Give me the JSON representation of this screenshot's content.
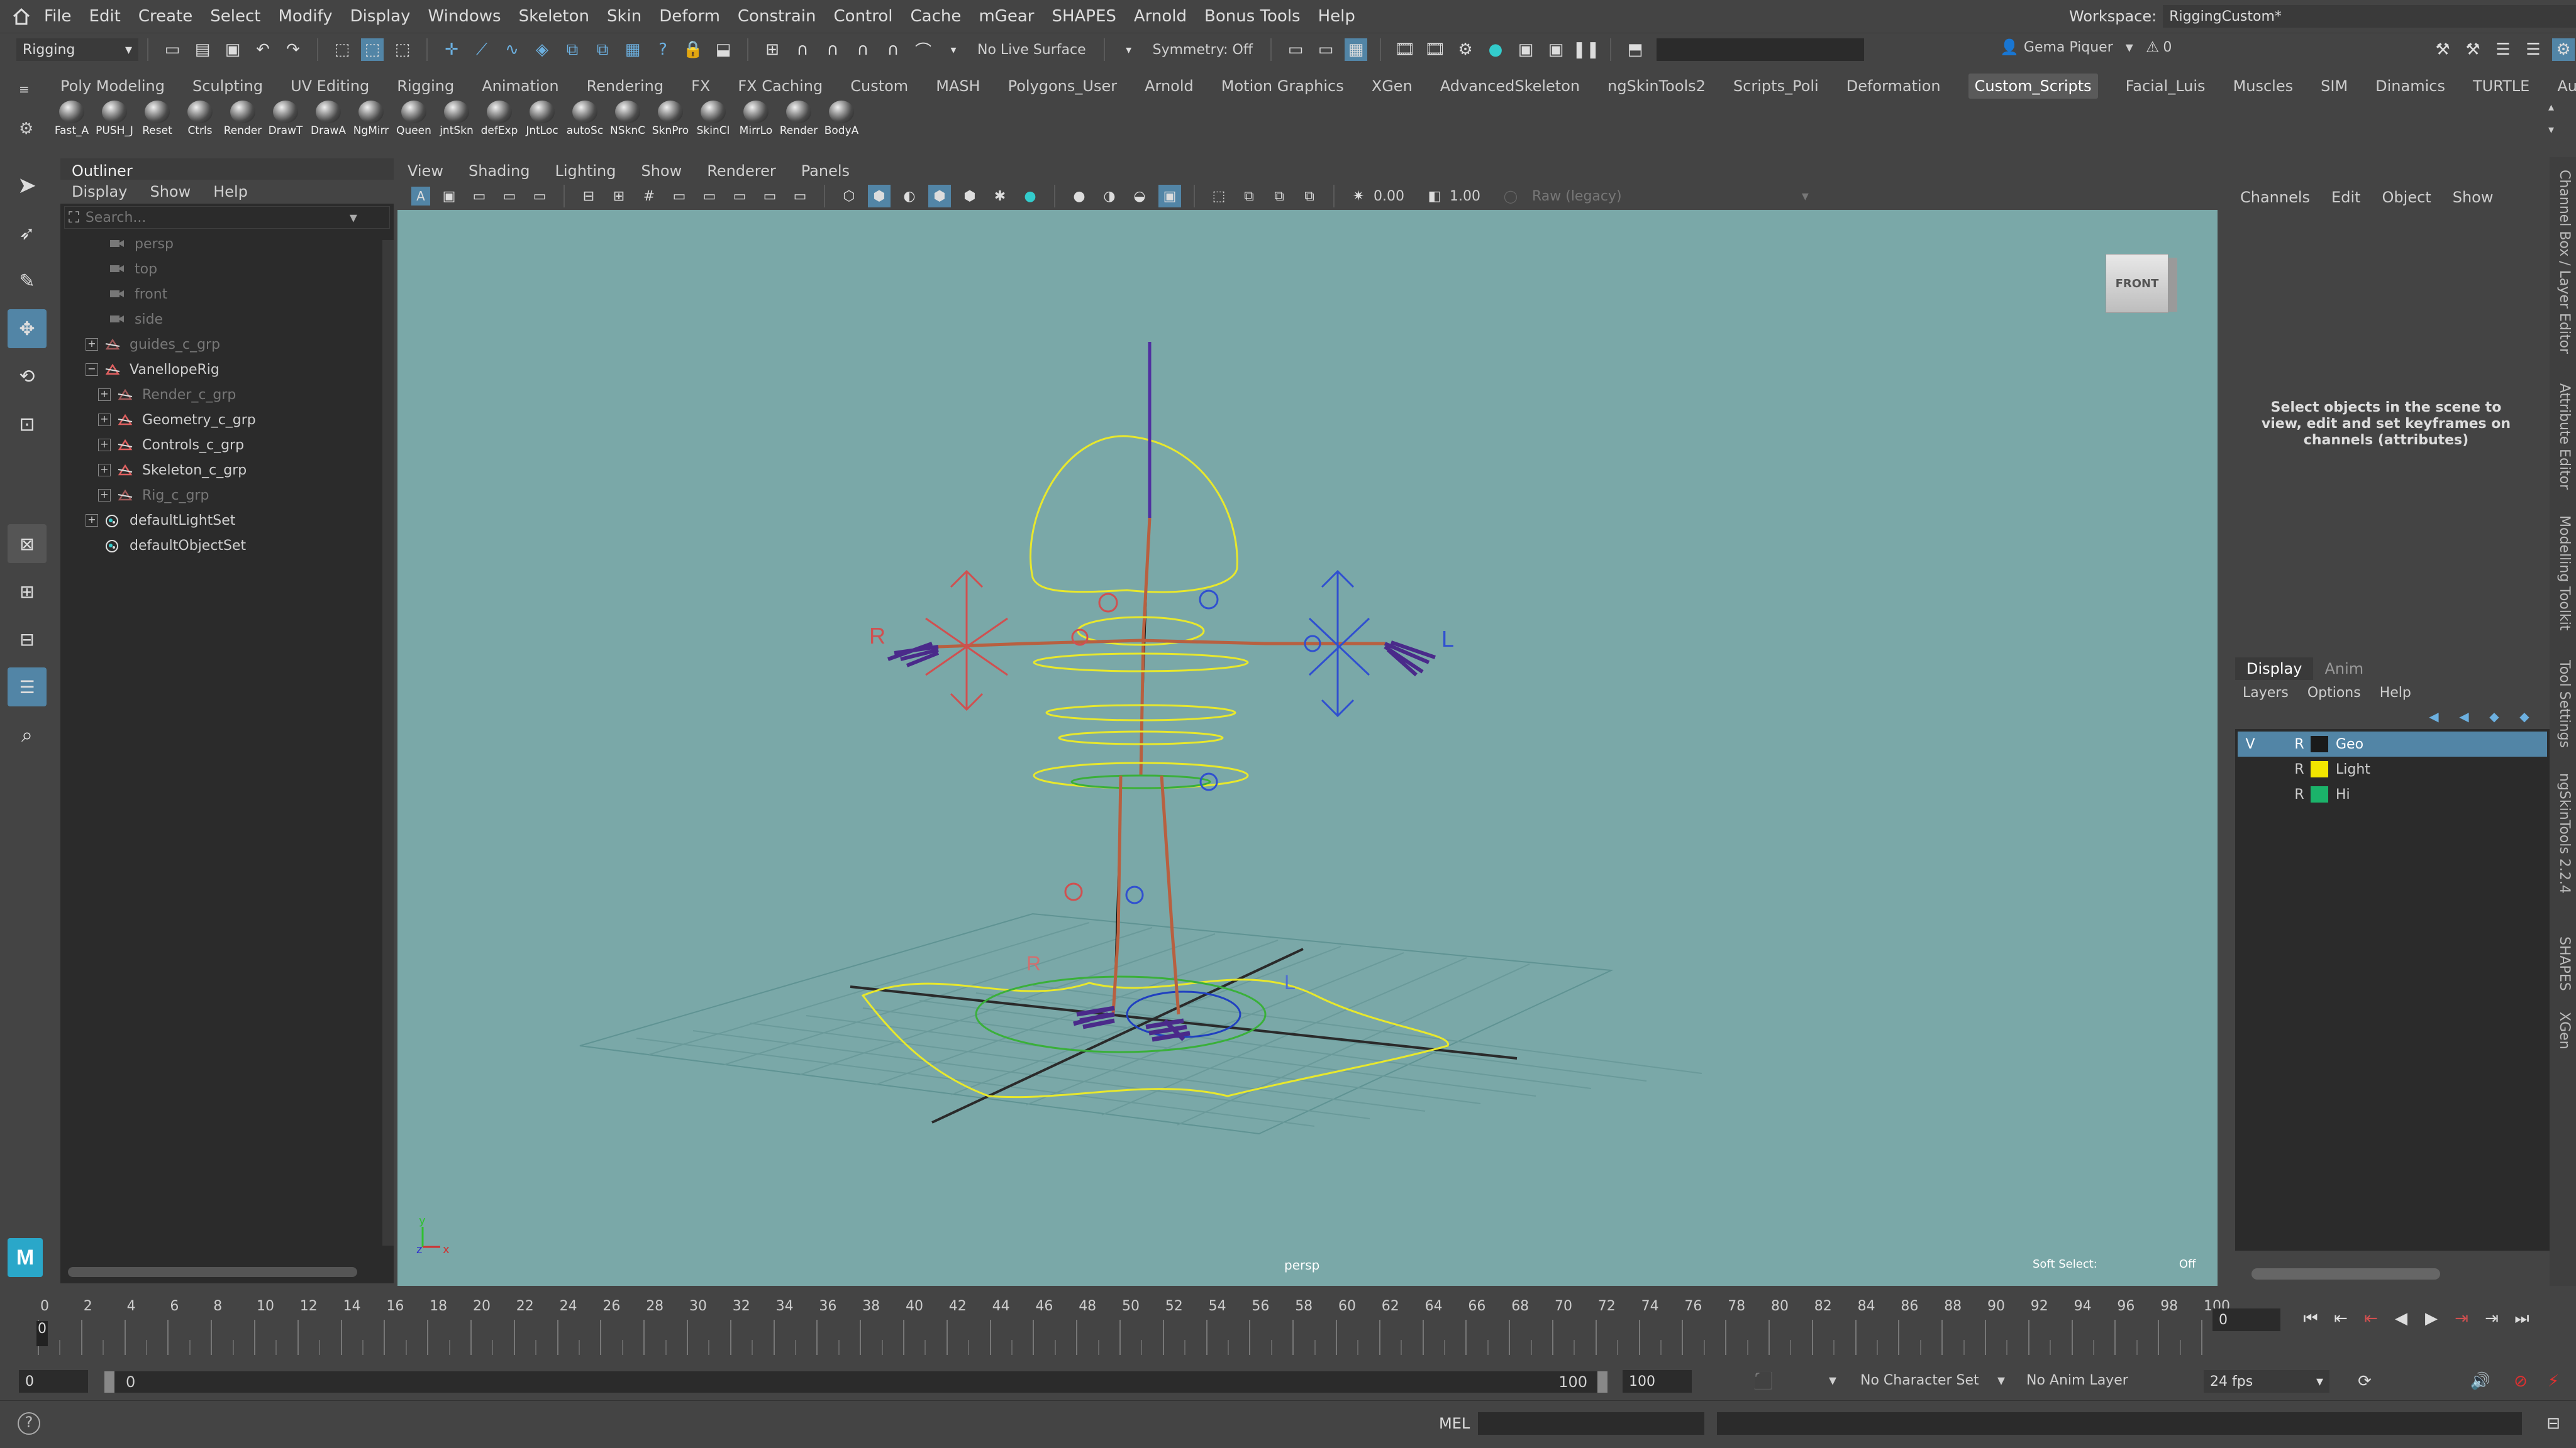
{
  "menubar": {
    "items": [
      "File",
      "Edit",
      "Create",
      "Select",
      "Modify",
      "Display",
      "Windows",
      "Skeleton",
      "Skin",
      "Deform",
      "Constrain",
      "Control",
      "Cache",
      "mGear",
      "SHAPES",
      "Arnold",
      "Bonus Tools",
      "Help"
    ],
    "workspace_label": "Workspace:",
    "workspace_value": "RiggingCustom*"
  },
  "statusline": {
    "menuset": "Rigging",
    "live_surface": "No Live Surface",
    "symmetry": "Symmetry: Off",
    "user": "Gema Piquer",
    "warnings": "0"
  },
  "shelf": {
    "tabs": [
      "Poly Modeling",
      "Sculpting",
      "UV Editing",
      "Rigging",
      "Animation",
      "Rendering",
      "FX",
      "FX Caching",
      "Custom",
      "MASH",
      "Polygons_User",
      "Arnold",
      "Motion Graphics",
      "XGen",
      "AdvancedSkeleton",
      "ngSkinTools2",
      "Scripts_Poli",
      "Deformation",
      "Custom_Scripts",
      "Facial_Luis",
      "Muscles",
      "SIM",
      "Dinamics",
      "TURTLE",
      "AutoBipedRig"
    ],
    "active_tab": "Custom_Scripts",
    "buttons": [
      "Fast_A",
      "PUSH_J",
      "Reset",
      "Ctrls",
      "Render",
      "DrawT",
      "DrawA",
      "NgMirr",
      "Queen",
      "jntSkn",
      "defExp",
      "JntLoc",
      "autoSc",
      "NSknC",
      "SknPro",
      "SkinCl",
      "MirrLo",
      "Render",
      "BodyA"
    ]
  },
  "outliner": {
    "title": "Outliner",
    "menu": [
      "Display",
      "Show",
      "Help"
    ],
    "search_placeholder": "Search...",
    "items": [
      {
        "label": "persp",
        "dim": true
      },
      {
        "label": "top",
        "dim": true
      },
      {
        "label": "front",
        "dim": true
      },
      {
        "label": "side",
        "dim": true
      },
      {
        "label": "guides_c_grp",
        "dim": true
      },
      {
        "label": "VanellopeRig",
        "dim": false
      },
      {
        "label": "Render_c_grp",
        "dim": true
      },
      {
        "label": "Geometry_c_grp",
        "dim": false
      },
      {
        "label": "Controls_c_grp",
        "dim": false
      },
      {
        "label": "Skeleton_c_grp",
        "dim": false
      },
      {
        "label": "Rig_c_grp",
        "dim": true
      },
      {
        "label": "defaultLightSet",
        "dim": false
      },
      {
        "label": "defaultObjectSet",
        "dim": false
      }
    ]
  },
  "viewport": {
    "menu": [
      "View",
      "Shading",
      "Lighting",
      "Show",
      "Renderer",
      "Panels"
    ],
    "exposure": "0.00",
    "gamma": "1.00",
    "colorspace": "Raw (legacy)",
    "camera_label": "persp",
    "soft_select_label": "Soft Select:",
    "soft_select_value": "Off",
    "viewcube_label": "FRONT",
    "side_label_r": "R",
    "side_label_l": "L"
  },
  "channelbox": {
    "menu": [
      "Channels",
      "Edit",
      "Object",
      "Show"
    ],
    "empty_message": "Select objects in the scene to view, edit and set keyframes on channels (attributes)",
    "layer_tabs": [
      "Display",
      "Anim"
    ],
    "layer_menu": [
      "Layers",
      "Options",
      "Help"
    ],
    "layers": [
      {
        "v": "V",
        "r": "R",
        "name": "Geo",
        "color": "#1a1a1a",
        "selected": true
      },
      {
        "v": "",
        "r": "R",
        "name": "Light",
        "color": "#f2e600",
        "selected": false
      },
      {
        "v": "",
        "r": "R",
        "name": "Hi",
        "color": "#1bb36a",
        "selected": false
      }
    ]
  },
  "right_strip_tabs": [
    "Channel Box / Layer Editor",
    "Attribute Editor",
    "Modelling Toolkit",
    "Tool Settings",
    "ngSkinTools 2.2.4",
    "SHAPES",
    "XGen"
  ],
  "timeline": {
    "ticks": [
      "0",
      "2",
      "4",
      "6",
      "8",
      "10",
      "12",
      "14",
      "16",
      "18",
      "20",
      "22",
      "24",
      "26",
      "28",
      "30",
      "32",
      "34",
      "36",
      "38",
      "40",
      "42",
      "44",
      "46",
      "48",
      "50",
      "52",
      "54",
      "56",
      "58",
      "60",
      "62",
      "64",
      "66",
      "68",
      "70",
      "72",
      "74",
      "76",
      "78",
      "80",
      "82",
      "84",
      "86",
      "88",
      "90",
      "92",
      "94",
      "96",
      "98",
      "100"
    ],
    "current_frame": "0",
    "playhead_label": "0"
  },
  "range": {
    "start": "0",
    "inner_start": "0",
    "inner_end": "100",
    "end": "100",
    "character_set": "No Character Set",
    "anim_layer": "No Anim Layer",
    "fps": "24 fps"
  },
  "cmdline": {
    "language": "MEL",
    "help": "?"
  },
  "colors": {
    "viewport_bg": "#7aa8a8",
    "accent": "#5285a6",
    "panel": "#444444"
  }
}
